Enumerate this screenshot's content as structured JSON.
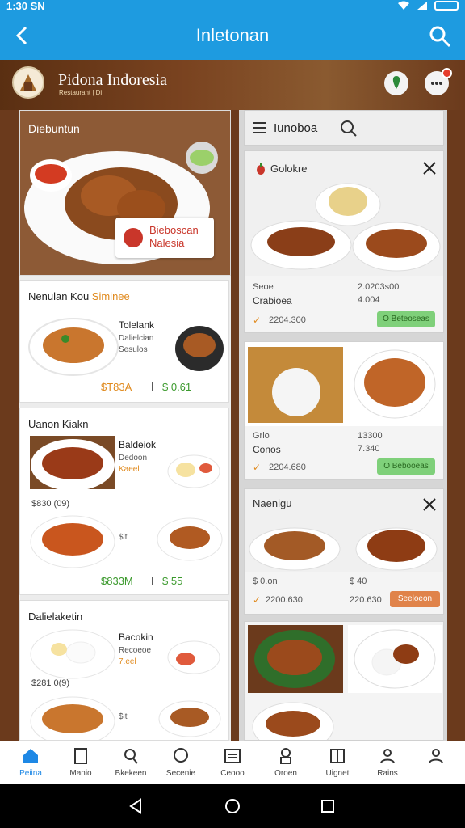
{
  "status": {
    "time": "1:30 SN",
    "indicator": "◐"
  },
  "app_bar": {
    "title": "Inletonan"
  },
  "hero": {
    "brand": "Pidona Indoresia",
    "subtitle": "Restaurant | Di"
  },
  "featured": {
    "label": "Diebuntun",
    "badge_line1": "Bieboscan",
    "badge_line2": "Nalesia"
  },
  "sections": [
    {
      "title_a": "Nenulan Kou",
      "title_b": "Siminee",
      "item": {
        "name": "Tolelank",
        "desc1": "Dalielcian",
        "desc2": "Sesulos"
      },
      "price_a": "$T83A",
      "price_sep": "|",
      "price_b": "$ 0.61"
    },
    {
      "title_a": "Uanon Kiakn",
      "item1": {
        "name": "Baldeiok",
        "desc1": "Dedoon",
        "desc2": "Kaeel"
      },
      "price_row1": "$830 (09)",
      "item2_tag": "$it",
      "price_a": "$833M",
      "price_sep": "|",
      "price_b": "$ 55"
    },
    {
      "title_a": "Dalielaketin",
      "item1": {
        "name": "Bacokin",
        "desc1": "Recoeoe",
        "desc2": "7.eel"
      },
      "price_row1": "$281 0(9)",
      "item2_tag": "$it"
    }
  ],
  "right": {
    "header": {
      "label": "Iunoboa"
    },
    "cards": [
      {
        "name": "Golokre",
        "code": "Seoe",
        "sub": "Crabioea",
        "num1": "2.0203s00",
        "num2": "4.004",
        "chev_num": "2204.300",
        "pill": "O Beteoseas"
      },
      {
        "name": "",
        "code": "Grio",
        "sub": "Conos",
        "num1": "13300",
        "num2": "7.340",
        "chev_num": "2204.680",
        "pill": "O Bebooeas"
      },
      {
        "name": "Naenigu",
        "code": "$ 0.on",
        "sub": "",
        "num1": "$ 40",
        "num2": "",
        "chev_num": "2200.630",
        "num3": "220.630",
        "pill": "Seeloeon"
      }
    ]
  },
  "bottom_nav": [
    {
      "label": "Peiina",
      "icon": "home-icon"
    },
    {
      "label": "Manio",
      "icon": "document-icon"
    },
    {
      "label": "Bkekeen",
      "icon": "search-icon"
    },
    {
      "label": "Secenie",
      "icon": "chat-icon"
    },
    {
      "label": "Ceooo",
      "icon": "list-icon"
    },
    {
      "label": "Oroen",
      "icon": "chef-icon"
    },
    {
      "label": "Uignet",
      "icon": "book-icon"
    },
    {
      "label": "Rains",
      "icon": "person-icon"
    },
    {
      "label": "",
      "icon": "profile-icon"
    }
  ],
  "colors": {
    "primary": "#1e9be0",
    "accent_orange": "#e08a1e",
    "accent_green": "#3c9a2e",
    "brand_red": "#c9362a"
  }
}
